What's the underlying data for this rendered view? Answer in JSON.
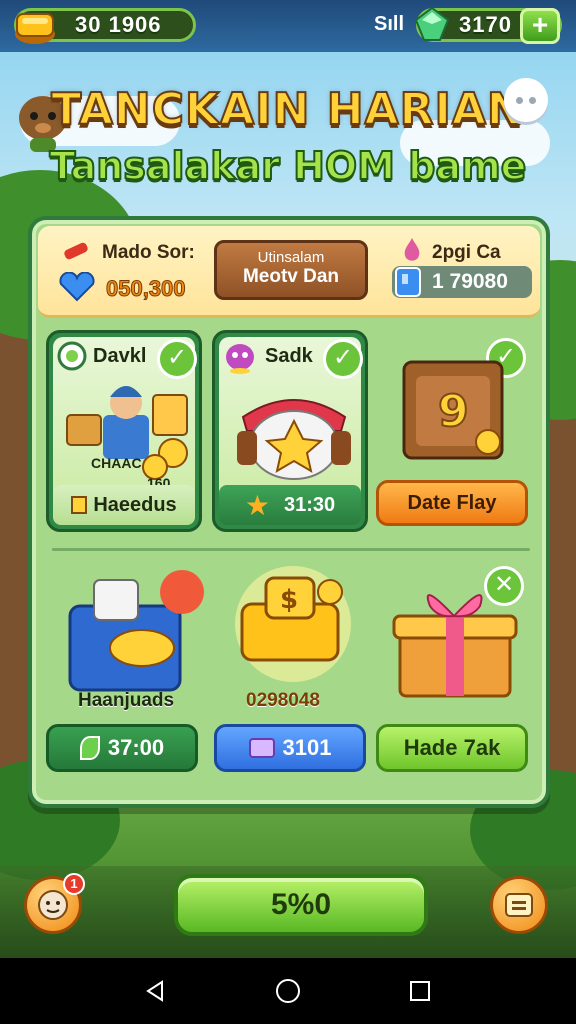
{
  "top_bar": {
    "coins_value": "30 1906",
    "signal_text": "Sıll",
    "gems_value": "3170",
    "add_label": "+"
  },
  "header": {
    "title": "TANCKAIN HARIAN",
    "subtitle": "Tansalakar HOM bame"
  },
  "panel": {
    "head": {
      "left_label": "Mado Sor:",
      "left_value": "050,300",
      "center_line1": "Utinsalam",
      "center_line2": "Meotv Dan",
      "right_label": "2pgi Ca",
      "right_value": "1 79080"
    },
    "cards": [
      {
        "title": "Davkl",
        "overlay_text": "CHAAC",
        "overlay_value": "160",
        "footer": "Haeedus"
      },
      {
        "title": "Sadk",
        "footer": "31:30"
      },
      {
        "footer": "Date Flay"
      }
    ],
    "rewards": [
      {
        "caption": "Haanjuads",
        "button": "37:00"
      },
      {
        "caption": "0298048",
        "button": "3101"
      },
      {
        "button": "Hade 7ak"
      }
    ]
  },
  "bottom": {
    "badge": "1",
    "main_button": "5%0"
  },
  "colors": {
    "accent_green": "#58b823",
    "accent_orange": "#f08a14",
    "title_gold": "#ffd23a",
    "subtitle_green": "#a6e34b"
  }
}
